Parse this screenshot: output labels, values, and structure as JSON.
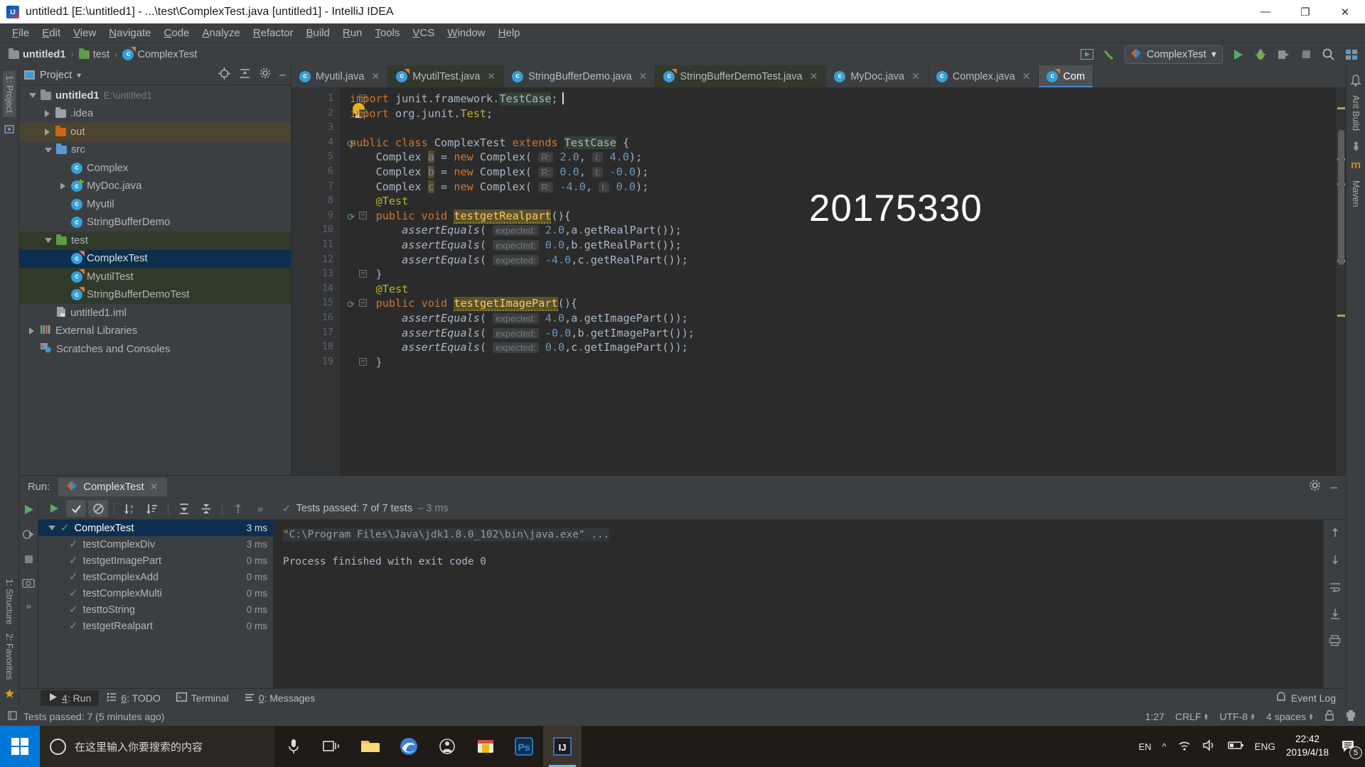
{
  "window": {
    "title": "untitled1 [E:\\untitled1] - ...\\test\\ComplexTest.java [untitled1] - IntelliJ IDEA",
    "minimize": "—",
    "maximize": "❐",
    "close": "✕"
  },
  "menubar": [
    {
      "label": "File"
    },
    {
      "label": "Edit"
    },
    {
      "label": "View"
    },
    {
      "label": "Navigate"
    },
    {
      "label": "Code"
    },
    {
      "label": "Analyze"
    },
    {
      "label": "Refactor"
    },
    {
      "label": "Build"
    },
    {
      "label": "Run"
    },
    {
      "label": "Tools"
    },
    {
      "label": "VCS"
    },
    {
      "label": "Window"
    },
    {
      "label": "Help"
    }
  ],
  "breadcrumb": {
    "items": [
      "untitled1",
      "test",
      "ComplexTest"
    ],
    "separator": "›"
  },
  "nav_right": {
    "run_config": "ComplexTest",
    "dropdown_arrow": "▾"
  },
  "project_panel": {
    "title": "Project",
    "dropdown": "▾",
    "tree": [
      {
        "label": "untitled1",
        "sub": "E:\\untitled1",
        "depth": 0,
        "arrow": "down",
        "icon": "folder-module",
        "bold": true,
        "state": "none"
      },
      {
        "label": ".idea",
        "sub": "",
        "depth": 1,
        "arrow": "right",
        "icon": "folder-gray",
        "bold": false,
        "state": "none"
      },
      {
        "label": "out",
        "sub": "",
        "depth": 1,
        "arrow": "right",
        "icon": "folder-orange",
        "bold": false,
        "state": "out"
      },
      {
        "label": "src",
        "sub": "",
        "depth": 1,
        "arrow": "down",
        "icon": "folder-blue",
        "bold": false,
        "state": "none"
      },
      {
        "label": "Complex",
        "sub": "",
        "depth": 2,
        "arrow": "none",
        "icon": "class",
        "bold": false,
        "state": "none"
      },
      {
        "label": "MyDoc.java",
        "sub": "",
        "depth": 2,
        "arrow": "right",
        "icon": "class-run",
        "bold": false,
        "state": "none"
      },
      {
        "label": "Myutil",
        "sub": "",
        "depth": 2,
        "arrow": "none",
        "icon": "class",
        "bold": false,
        "state": "none"
      },
      {
        "label": "StringBufferDemo",
        "sub": "",
        "depth": 2,
        "arrow": "none",
        "icon": "class",
        "bold": false,
        "state": "none"
      },
      {
        "label": "test",
        "sub": "",
        "depth": 1,
        "arrow": "down",
        "icon": "folder-green",
        "bold": false,
        "state": "test"
      },
      {
        "label": "ComplexTest",
        "sub": "",
        "depth": 2,
        "arrow": "none",
        "icon": "class-test",
        "bold": false,
        "state": "selected"
      },
      {
        "label": "MyutilTest",
        "sub": "",
        "depth": 2,
        "arrow": "none",
        "icon": "class-test",
        "bold": false,
        "state": "test"
      },
      {
        "label": "StringBufferDemoTest",
        "sub": "",
        "depth": 2,
        "arrow": "none",
        "icon": "class-test",
        "bold": false,
        "state": "test"
      },
      {
        "label": "untitled1.iml",
        "sub": "",
        "depth": 1,
        "arrow": "none",
        "icon": "iml",
        "bold": false,
        "state": "none"
      },
      {
        "label": "External Libraries",
        "sub": "",
        "depth": 0,
        "arrow": "right",
        "icon": "library",
        "bold": false,
        "state": "none"
      },
      {
        "label": "Scratches and Consoles",
        "sub": "",
        "depth": 0,
        "arrow": "none",
        "icon": "scratch",
        "bold": false,
        "state": "none"
      }
    ]
  },
  "editor_tabs": [
    {
      "label": "Myutil.java",
      "icon": "class",
      "state": "plain",
      "close": "✕"
    },
    {
      "label": "MyutilTest.java",
      "icon": "class-test",
      "state": "test",
      "close": "✕"
    },
    {
      "label": "StringBufferDemo.java",
      "icon": "class",
      "state": "plain",
      "close": "✕"
    },
    {
      "label": "StringBufferDemoTest.java",
      "icon": "class-test",
      "state": "test",
      "close": "✕"
    },
    {
      "label": "MyDoc.java",
      "icon": "class",
      "state": "plain",
      "close": "✕"
    },
    {
      "label": "Complex.java",
      "icon": "class",
      "state": "plain",
      "close": "✕"
    },
    {
      "label": "Com",
      "icon": "class-test",
      "state": "selected",
      "close": ""
    }
  ],
  "editor": {
    "watermark": "20175330",
    "line_numbers": [
      "1",
      "2",
      "3",
      "4",
      "5",
      "6",
      "7",
      "8",
      "9",
      "10",
      "11",
      "12",
      "13",
      "14",
      "15",
      "16",
      "17",
      "18",
      "19"
    ],
    "code_lines": [
      {
        "n": 1,
        "tokens": [
          {
            "t": "import",
            "c": "kw"
          },
          {
            "t": " junit.framework.",
            "c": "plain"
          },
          {
            "t": "Test",
            "c": "plain hl-usage"
          },
          {
            "t": "Case",
            "c": "plain hl-usage"
          },
          {
            "t": ";",
            "c": "plain"
          }
        ]
      },
      {
        "n": 2,
        "tokens": [
          {
            "t": "import",
            "c": "kw"
          },
          {
            "t": " org.junit.",
            "c": "plain"
          },
          {
            "t": "Test",
            "c": "ann"
          },
          {
            "t": ";",
            "c": "plain"
          }
        ]
      },
      {
        "n": 3,
        "tokens": []
      },
      {
        "n": 4,
        "tokens": [
          {
            "t": "public class",
            "c": "kw"
          },
          {
            "t": " ComplexTest ",
            "c": "cls"
          },
          {
            "t": "extends",
            "c": "kw"
          },
          {
            "t": " ",
            "c": "plain"
          },
          {
            "t": "TestCase",
            "c": "cls hl-usage"
          },
          {
            "t": " {",
            "c": "plain"
          }
        ]
      },
      {
        "n": 5,
        "tokens": [
          {
            "t": "    Complex ",
            "c": "cls"
          },
          {
            "t": "a",
            "c": "fld varcol"
          },
          {
            "t": " = ",
            "c": "plain"
          },
          {
            "t": "new",
            "c": "kw"
          },
          {
            "t": " Complex( ",
            "c": "cls"
          },
          {
            "t": "R:",
            "c": "hintpill"
          },
          {
            "t": " ",
            "c": "plain"
          },
          {
            "t": "2.0",
            "c": "num"
          },
          {
            "t": ", ",
            "c": "plain"
          },
          {
            "t": "I:",
            "c": "hintpill"
          },
          {
            "t": " ",
            "c": "plain"
          },
          {
            "t": "4.0",
            "c": "num"
          },
          {
            "t": ");",
            "c": "plain"
          }
        ]
      },
      {
        "n": 6,
        "tokens": [
          {
            "t": "    Complex ",
            "c": "cls"
          },
          {
            "t": "b",
            "c": "fld varcol"
          },
          {
            "t": " = ",
            "c": "plain"
          },
          {
            "t": "new",
            "c": "kw"
          },
          {
            "t": " Complex( ",
            "c": "cls"
          },
          {
            "t": "R:",
            "c": "hintpill"
          },
          {
            "t": " ",
            "c": "plain"
          },
          {
            "t": "0.0",
            "c": "num"
          },
          {
            "t": ", ",
            "c": "plain"
          },
          {
            "t": "I:",
            "c": "hintpill"
          },
          {
            "t": " ",
            "c": "plain"
          },
          {
            "t": "-0.0",
            "c": "num"
          },
          {
            "t": ");",
            "c": "plain"
          }
        ]
      },
      {
        "n": 7,
        "tokens": [
          {
            "t": "    Complex ",
            "c": "cls"
          },
          {
            "t": "c",
            "c": "fld varcol"
          },
          {
            "t": " = ",
            "c": "plain"
          },
          {
            "t": "new",
            "c": "kw"
          },
          {
            "t": " Complex( ",
            "c": "cls"
          },
          {
            "t": "R:",
            "c": "hintpill"
          },
          {
            "t": " ",
            "c": "plain"
          },
          {
            "t": "-4.0",
            "c": "num"
          },
          {
            "t": ", ",
            "c": "plain"
          },
          {
            "t": "I:",
            "c": "hintpill"
          },
          {
            "t": " ",
            "c": "plain"
          },
          {
            "t": "0.0",
            "c": "num"
          },
          {
            "t": ");",
            "c": "plain"
          }
        ]
      },
      {
        "n": 8,
        "tokens": [
          {
            "t": "    @Test",
            "c": "ann"
          }
        ]
      },
      {
        "n": 9,
        "tokens": [
          {
            "t": "    ",
            "c": "plain"
          },
          {
            "t": "public void",
            "c": "kw"
          },
          {
            "t": " ",
            "c": "plain"
          },
          {
            "t": "testgetRealpart",
            "c": "mth hl-ident hl-warn"
          },
          {
            "t": "(){",
            "c": "plain"
          }
        ]
      },
      {
        "n": 10,
        "tokens": [
          {
            "t": "        ",
            "c": "plain"
          },
          {
            "t": "assertEquals",
            "c": "plain italic"
          },
          {
            "t": "( ",
            "c": "plain"
          },
          {
            "t": "expected:",
            "c": "hintpill"
          },
          {
            "t": " ",
            "c": "plain"
          },
          {
            "t": "2.0",
            "c": "num"
          },
          {
            "t": ",a",
            "c": "plain"
          },
          {
            "t": ".",
            "c": "fld"
          },
          {
            "t": "getRealPart());",
            "c": "plain"
          }
        ]
      },
      {
        "n": 11,
        "tokens": [
          {
            "t": "        ",
            "c": "plain"
          },
          {
            "t": "assertEquals",
            "c": "plain italic"
          },
          {
            "t": "( ",
            "c": "plain"
          },
          {
            "t": "expected:",
            "c": "hintpill"
          },
          {
            "t": " ",
            "c": "plain"
          },
          {
            "t": "0.0",
            "c": "num"
          },
          {
            "t": ",b",
            "c": "plain"
          },
          {
            "t": ".",
            "c": "fld"
          },
          {
            "t": "getRealPart());",
            "c": "plain"
          }
        ]
      },
      {
        "n": 12,
        "tokens": [
          {
            "t": "        ",
            "c": "plain"
          },
          {
            "t": "assertEquals",
            "c": "plain italic"
          },
          {
            "t": "( ",
            "c": "plain"
          },
          {
            "t": "expected:",
            "c": "hintpill"
          },
          {
            "t": " ",
            "c": "plain"
          },
          {
            "t": "-4.0",
            "c": "num"
          },
          {
            "t": ",c",
            "c": "plain"
          },
          {
            "t": ".",
            "c": "fld"
          },
          {
            "t": "getRealPart());",
            "c": "plain"
          }
        ]
      },
      {
        "n": 13,
        "tokens": [
          {
            "t": "    }",
            "c": "plain"
          }
        ]
      },
      {
        "n": 14,
        "tokens": [
          {
            "t": "    @Test",
            "c": "ann"
          }
        ]
      },
      {
        "n": 15,
        "tokens": [
          {
            "t": "    ",
            "c": "plain"
          },
          {
            "t": "public void",
            "c": "kw"
          },
          {
            "t": " ",
            "c": "plain"
          },
          {
            "t": "testgetImagePart",
            "c": "mth hl-ident hl-warn"
          },
          {
            "t": "(){",
            "c": "plain"
          }
        ]
      },
      {
        "n": 16,
        "tokens": [
          {
            "t": "        ",
            "c": "plain"
          },
          {
            "t": "assertEquals",
            "c": "plain italic"
          },
          {
            "t": "( ",
            "c": "plain"
          },
          {
            "t": "expected:",
            "c": "hintpill"
          },
          {
            "t": " ",
            "c": "plain"
          },
          {
            "t": "4.0",
            "c": "num"
          },
          {
            "t": ",a",
            "c": "plain"
          },
          {
            "t": ".",
            "c": "fld"
          },
          {
            "t": "getImagePart());",
            "c": "plain"
          }
        ]
      },
      {
        "n": 17,
        "tokens": [
          {
            "t": "        ",
            "c": "plain"
          },
          {
            "t": "assertEquals",
            "c": "plain italic"
          },
          {
            "t": "( ",
            "c": "plain"
          },
          {
            "t": "expected:",
            "c": "hintpill"
          },
          {
            "t": " ",
            "c": "plain"
          },
          {
            "t": "-0.0",
            "c": "num"
          },
          {
            "t": ",b",
            "c": "plain"
          },
          {
            "t": ".",
            "c": "fld"
          },
          {
            "t": "getImagePart());",
            "c": "plain"
          }
        ]
      },
      {
        "n": 18,
        "tokens": [
          {
            "t": "        ",
            "c": "plain"
          },
          {
            "t": "assertEquals",
            "c": "plain italic"
          },
          {
            "t": "( ",
            "c": "plain"
          },
          {
            "t": "expected:",
            "c": "hintpill"
          },
          {
            "t": " ",
            "c": "plain"
          },
          {
            "t": "0.0",
            "c": "num"
          },
          {
            "t": ",c",
            "c": "plain"
          },
          {
            "t": ".",
            "c": "fld"
          },
          {
            "t": "getImagePart());",
            "c": "plain"
          }
        ]
      },
      {
        "n": 19,
        "tokens": [
          {
            "t": "    }",
            "c": "plain"
          }
        ]
      }
    ],
    "run_marker_lines": [
      4,
      9,
      15
    ],
    "fold_lines": [
      1,
      2,
      9,
      13,
      15,
      19
    ]
  },
  "run_window": {
    "label": "Run:",
    "tab_label": "ComplexTest",
    "tab_close": "✕",
    "status_text": "Tests passed: 7 of 7 tests",
    "status_duration": "– 3 ms",
    "expand_arrow": "»",
    "test_tree": [
      {
        "label": "ComplexTest",
        "duration": "3 ms",
        "depth": 0,
        "selected": true
      },
      {
        "label": "testComplexDiv",
        "duration": "3 ms",
        "depth": 1,
        "selected": false
      },
      {
        "label": "testgetImagePart",
        "duration": "0 ms",
        "depth": 1,
        "selected": false
      },
      {
        "label": "testComplexAdd",
        "duration": "0 ms",
        "depth": 1,
        "selected": false
      },
      {
        "label": "testComplexMulti",
        "duration": "0 ms",
        "depth": 1,
        "selected": false
      },
      {
        "label": "testtoString",
        "duration": "0 ms",
        "depth": 1,
        "selected": false
      },
      {
        "label": "testgetRealpart",
        "duration": "0 ms",
        "depth": 1,
        "selected": false
      }
    ],
    "console": {
      "command": "\"C:\\Program Files\\Java\\jdk1.8.0_102\\bin\\java.exe\" ...",
      "output": "Process finished with exit code 0"
    }
  },
  "tool_strip": {
    "items": [
      {
        "num": "4",
        "label": ": Run",
        "icon": "play-icon",
        "active": true
      },
      {
        "num": "6",
        "label": ": TODO",
        "icon": "list-icon",
        "active": false
      },
      {
        "num": "",
        "label": "Terminal",
        "icon": "terminal-icon",
        "active": false
      },
      {
        "num": "0",
        "label": ": Messages",
        "icon": "messages-icon",
        "active": false
      }
    ],
    "event_log": "Event Log"
  },
  "statusbar": {
    "message": "Tests passed: 7 (5 minutes ago)",
    "caret": "1:27",
    "line_sep": "CRLF",
    "encoding": "UTF-8",
    "indent": "4 spaces",
    "spinner": "⇅"
  },
  "left_rail": {
    "project": "1: Project",
    "structure": "1: Structure",
    "favorites": "2: Favorites"
  },
  "right_rail": {
    "ant_build": "Ant Build",
    "maven": "Maven"
  },
  "taskbar": {
    "search_placeholder": "在这里输入你要搜索的内容",
    "lang_small": "EN",
    "lang": "ENG",
    "time": "22:42",
    "date": "2019/4/18",
    "notif_count": "5",
    "items": [
      {
        "name": "task-view-icon",
        "open": false
      },
      {
        "name": "file-explorer-icon",
        "open": false
      },
      {
        "name": "edge-browser-icon",
        "open": false
      },
      {
        "name": "app-icon",
        "open": false
      },
      {
        "name": "microsoft-store-icon",
        "open": false
      },
      {
        "name": "photoshop-icon",
        "open": false
      },
      {
        "name": "intellij-idea-icon",
        "open": true
      }
    ]
  },
  "colors": {
    "accent": "#4a88c7",
    "pass_green": "#59a869",
    "bg_panel": "#3c3f41",
    "bg_editor": "#2b2b2b",
    "select_blue": "#0d2f4f"
  }
}
